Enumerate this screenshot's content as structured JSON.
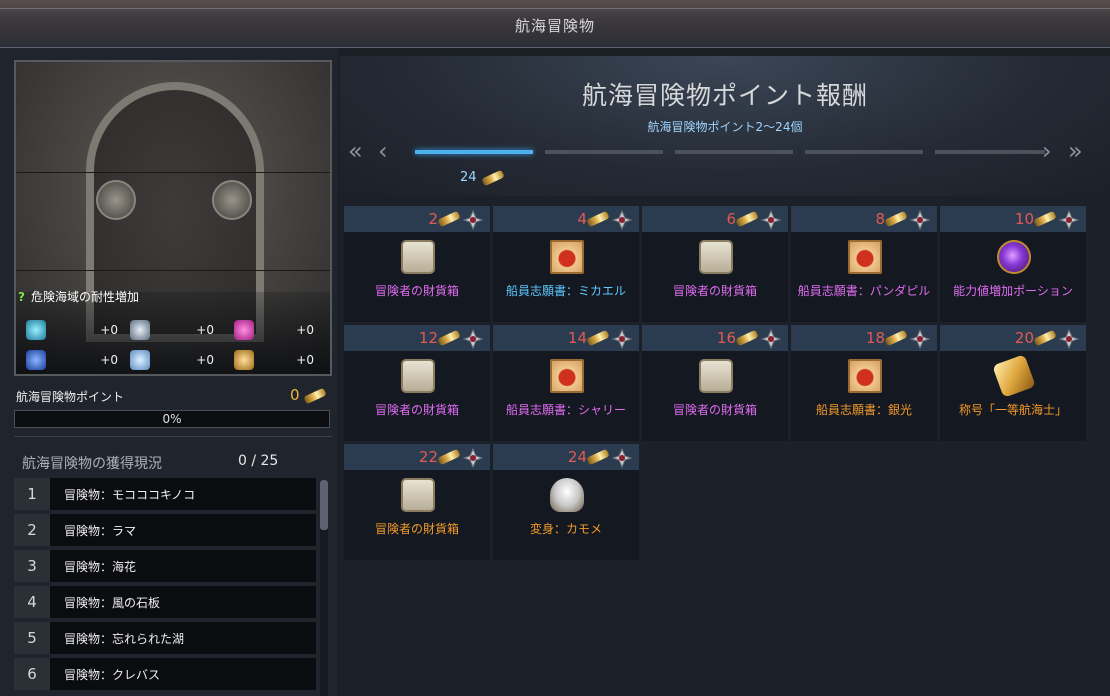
{
  "window": {
    "title": "航海冒険物"
  },
  "left": {
    "resist_title": "危険海域の耐性増加",
    "resist_stats": [
      {
        "icon": "water-vortex-icon",
        "value": "+0",
        "color": "#46c8e8"
      },
      {
        "icon": "storm-icon",
        "value": "+0",
        "color": "#a8b8cc"
      },
      {
        "icon": "pink-creature-icon",
        "value": "+0",
        "color": "#e040c0"
      },
      {
        "icon": "wave-icon",
        "value": "+0",
        "color": "#3a7af0"
      },
      {
        "icon": "ice-icon",
        "value": "+0",
        "color": "#a0d0ff"
      },
      {
        "icon": "tornado-icon",
        "value": "+0",
        "color": "#e0a040"
      }
    ],
    "points_label": "航海冒険物ポイント",
    "points_value": "0",
    "progress_text": "0%",
    "progress_fraction": 0,
    "acq_label": "航海冒険物の獲得現況",
    "acq_count": "0 / 25",
    "list": [
      {
        "num": "1",
        "name": "冒険物：モコココキノコ"
      },
      {
        "num": "2",
        "name": "冒険物：ラマ"
      },
      {
        "num": "3",
        "name": "冒険物：海花"
      },
      {
        "num": "4",
        "name": "冒険物：風の石板"
      },
      {
        "num": "5",
        "name": "冒険物：忘れられた湖"
      },
      {
        "num": "6",
        "name": "冒険物：クレバス"
      }
    ]
  },
  "reward": {
    "title": "航海冒険物ポイント報酬",
    "subtitle": "航海冒険物ポイント2～24個",
    "nav_prev_double": "«",
    "nav_prev": "‹",
    "nav_next": "›",
    "nav_next_double": "»",
    "segment_label": "24",
    "active_segment": 1,
    "cells": [
      {
        "pts": "2",
        "name": "冒険者の財貨箱",
        "color": "purple",
        "icon": "chest-icon"
      },
      {
        "pts": "4",
        "name": "船員志願書：ミカエル",
        "color": "blue",
        "icon": "letter-icon"
      },
      {
        "pts": "6",
        "name": "冒険者の財貨箱",
        "color": "purple",
        "icon": "chest-icon"
      },
      {
        "pts": "8",
        "name": "船員志願書：パンダピル",
        "color": "purple",
        "icon": "letter-icon"
      },
      {
        "pts": "10",
        "name": "能力値増加ポーション",
        "color": "purple",
        "icon": "potion-icon"
      },
      {
        "pts": "12",
        "name": "冒険者の財貨箱",
        "color": "purple",
        "icon": "chest-icon"
      },
      {
        "pts": "14",
        "name": "船員志願書：シャリー",
        "color": "purple",
        "icon": "letter-icon"
      },
      {
        "pts": "16",
        "name": "冒険者の財貨箱",
        "color": "purple",
        "icon": "chest-icon"
      },
      {
        "pts": "18",
        "name": "船員志願書：銀光",
        "color": "orange",
        "icon": "letter-icon"
      },
      {
        "pts": "20",
        "name": "称号「一等航海士」",
        "color": "orange",
        "icon": "title-scroll-icon"
      },
      {
        "pts": "22",
        "name": "冒険者の財貨箱",
        "color": "orange",
        "icon": "chest-icon"
      },
      {
        "pts": "24",
        "name": "変身：カモメ",
        "color": "orange",
        "icon": "seagull-icon"
      }
    ]
  }
}
